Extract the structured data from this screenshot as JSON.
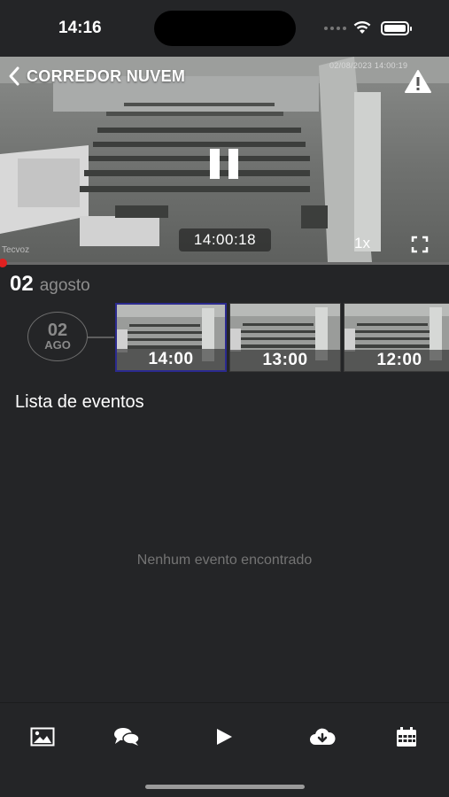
{
  "status": {
    "time": "14:16"
  },
  "camera": {
    "title": "CORREDOR NUVEM",
    "overlay_stamp": "02/08/2023 14:00:19",
    "watermark": "Tecvoz",
    "current_time": "14:00:18",
    "speed": "1x",
    "progress": 0.005
  },
  "date": {
    "day": "02",
    "month": "agosto"
  },
  "timeline": {
    "date_day": "02",
    "date_month": "AGO",
    "thumbnails": [
      {
        "label": "14:00",
        "selected": true
      },
      {
        "label": "13:00",
        "selected": false
      },
      {
        "label": "12:00",
        "selected": false
      }
    ]
  },
  "events": {
    "title": "Lista de eventos",
    "empty_message": "Nenhum evento encontrado"
  },
  "tabs": [
    {
      "icon": "image-icon"
    },
    {
      "icon": "chat-icon"
    },
    {
      "icon": "play-icon"
    },
    {
      "icon": "cloud-download-icon"
    },
    {
      "icon": "calendar-icon"
    }
  ],
  "colors": {
    "background": "#242527",
    "progress": "#e02020",
    "thumb_selected_border": "#2b2a8f"
  }
}
